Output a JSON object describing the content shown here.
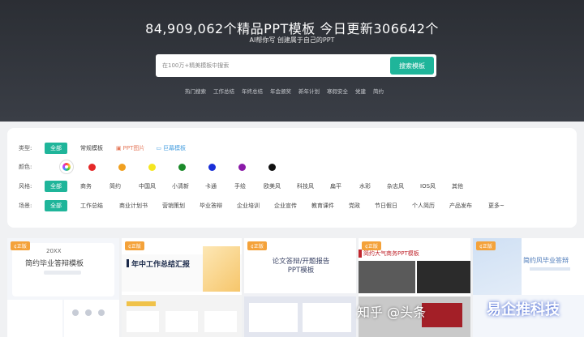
{
  "hero": {
    "title": "84,909,062个精品PPT模板  今日更新306642个",
    "subtitle": "AI帮你写 创建属于自己的PPT"
  },
  "search": {
    "placeholder": "在100万+精美模板中搜索",
    "button_label": "搜索模板"
  },
  "hot_links": [
    "热门搜索",
    "工作总结",
    "年终总结",
    "年会颁奖",
    "新年计划",
    "寒假安全",
    "党建",
    "简约"
  ],
  "filters": {
    "type": {
      "label": "类型:",
      "items": [
        "全部",
        "常规模板",
        "PPT图片",
        "巨幕模板"
      ]
    },
    "color": {
      "label": "颜色:",
      "colors": [
        "#e52828",
        "#f0a020",
        "#f5e620",
        "#1c8a2a",
        "#1a2fd8",
        "#8a1aa8",
        "#111111"
      ]
    },
    "style": {
      "label": "风格:",
      "items": [
        "全部",
        "商务",
        "简约",
        "中国风",
        "小清新",
        "卡通",
        "手绘",
        "欧美风",
        "科技风",
        "扁平",
        "水彩",
        "杂志风",
        "IOS风",
        "其他"
      ]
    },
    "scene": {
      "label": "场景:",
      "items": [
        "全部",
        "工作总结",
        "商业计划书",
        "营销策划",
        "毕业答辩",
        "企业培训",
        "企业宣传",
        "教育课件",
        "党政",
        "节日假日",
        "个人简历",
        "产品发布"
      ],
      "more": "更多~"
    }
  },
  "cards": [
    {
      "badge": "¢正版",
      "title": "简约毕业答辩模板",
      "year": "20XX"
    },
    {
      "badge": "¢正版",
      "title": "年中工作总结汇报"
    },
    {
      "badge": "¢正版",
      "title": "论文答辩/开题报告PPT模板"
    },
    {
      "badge": "¢正版",
      "title": "简约大气商务PPT模板"
    },
    {
      "badge": "¢正版",
      "title": "简约风毕业答辩"
    }
  ],
  "watermark": {
    "left": "知乎 @头条",
    "right": "易企推科技"
  }
}
